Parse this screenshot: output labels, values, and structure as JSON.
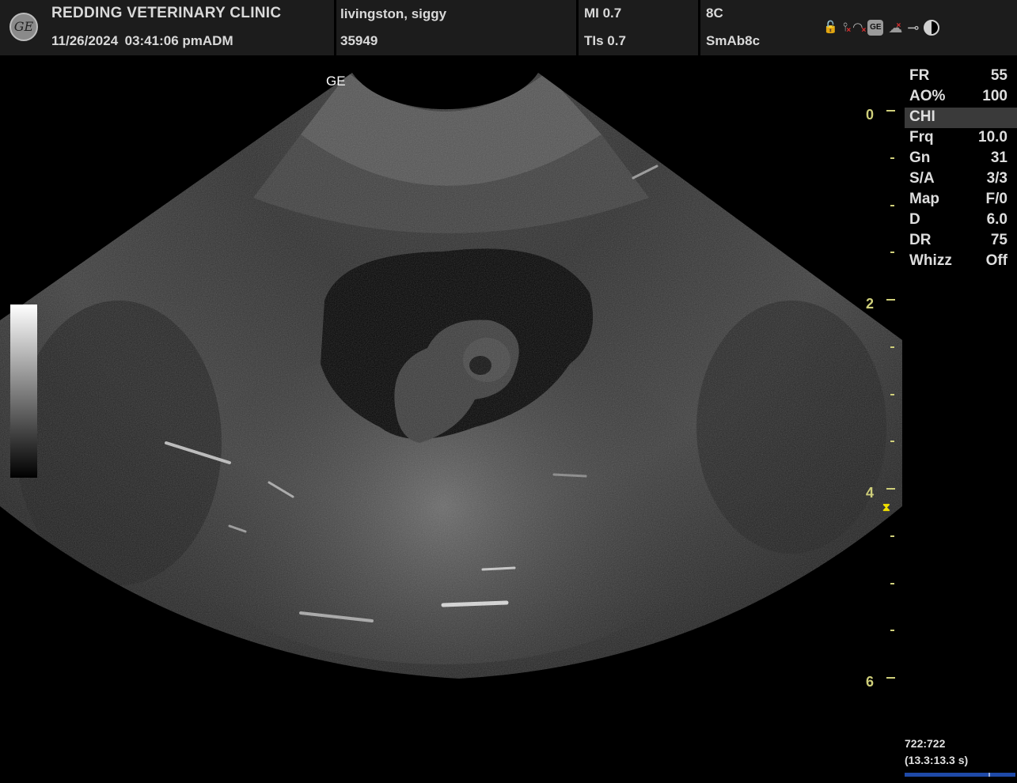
{
  "header": {
    "clinic_name": "REDDING VETERINARY CLINIC",
    "datetime": "11/26/2024",
    "time": "03:41:06 pm",
    "operator": "ADM",
    "patient_name": "livingston, siggy",
    "patient_id": "35949",
    "mi": "MI 0.7",
    "tis": "TIs 0.7",
    "probe": "8C",
    "preset": "SmAb8c",
    "logo_text": "GE",
    "status_icons": [
      "lock-icon",
      "usb-icon",
      "wifi-icon",
      "ge-box-icon",
      "cloud-icon",
      "plug-icon",
      "contrast-icon"
    ],
    "ge_box_text": "GE"
  },
  "image": {
    "orientation_marker": "GE"
  },
  "depth_scale": {
    "labels": [
      "0",
      "2",
      "4",
      "6"
    ],
    "unit": "cm",
    "focus_depth_cm": 4.2,
    "label_color": "#cfcf7a",
    "focus_color": "#f0e000"
  },
  "parameters": [
    {
      "key": "FR",
      "value": "55"
    },
    {
      "key": "AO%",
      "value": "100"
    },
    {
      "key": "CHI",
      "value": "",
      "highlight": true
    },
    {
      "key": "Frq",
      "value": "10.0"
    },
    {
      "key": "Gn",
      "value": "31"
    },
    {
      "key": "S/A",
      "value": "3/3"
    },
    {
      "key": "Map",
      "value": "F/0"
    },
    {
      "key": "D",
      "value": "6.0"
    },
    {
      "key": "DR",
      "value": "75"
    },
    {
      "key": "Whizz",
      "value": "Off"
    }
  ],
  "cine": {
    "frames": "722:722",
    "time": "(13.3:13.3 s)",
    "bar_color": "#1f4aa8"
  }
}
